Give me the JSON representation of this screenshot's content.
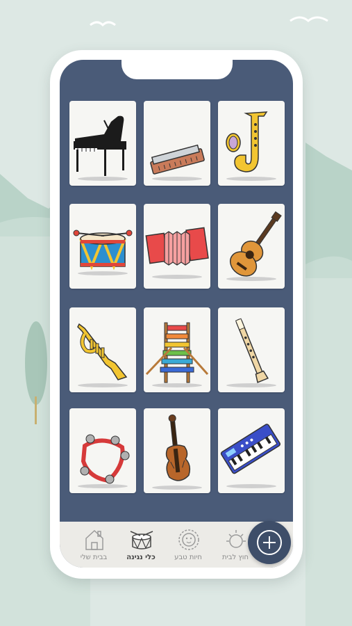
{
  "colors": {
    "background": "#dde8e4",
    "screen": "#4a5b78",
    "card": "#f6f6f3",
    "tabbar": "#ecebe7",
    "fab": "#3e4e69"
  },
  "instrument_cards": [
    {
      "icon": "grand-piano-icon"
    },
    {
      "icon": "harmonica-icon"
    },
    {
      "icon": "saxophone-icon"
    },
    {
      "icon": "drum-icon"
    },
    {
      "icon": "accordion-icon"
    },
    {
      "icon": "guitar-icon"
    },
    {
      "icon": "trumpet-icon"
    },
    {
      "icon": "xylophone-icon"
    },
    {
      "icon": "recorder-flute-icon"
    },
    {
      "icon": "tambourine-icon"
    },
    {
      "icon": "violin-icon"
    },
    {
      "icon": "keyboard-icon"
    }
  ],
  "tabbar": {
    "tabs": [
      {
        "label": "חוץ לבית",
        "icon": "sun-icon"
      },
      {
        "label": "חיות טבע",
        "icon": "lion-icon"
      },
      {
        "label": "כלי נגינה",
        "icon": "drum-tab-icon",
        "active": true
      },
      {
        "label": "בבית שלי",
        "icon": "house-icon"
      }
    ]
  },
  "fab": {
    "icon": "plus-icon"
  }
}
